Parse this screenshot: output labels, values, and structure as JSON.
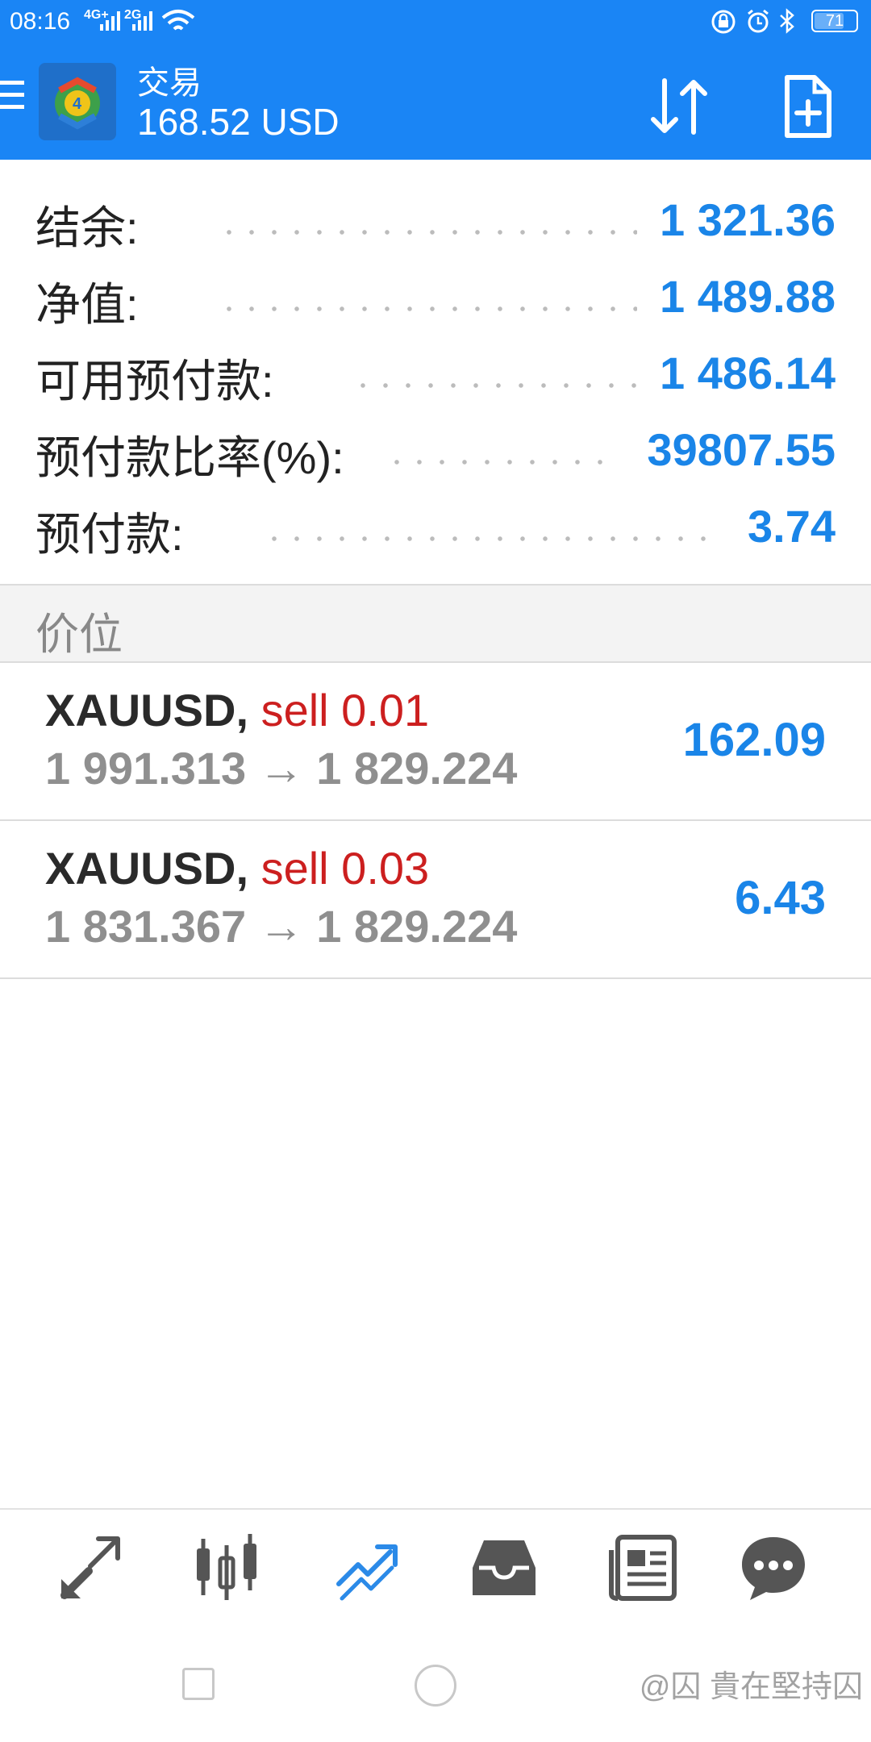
{
  "status_bar": {
    "time": "08:16",
    "net1": "4G+",
    "net2": "2G",
    "battery": "71"
  },
  "header": {
    "title": "交易",
    "subtitle": "168.52 USD",
    "icons": [
      "menu-icon",
      "app-logo",
      "sort-icon",
      "new-order-icon"
    ]
  },
  "summary": [
    {
      "label": "结余:",
      "value": "1 321.36"
    },
    {
      "label": "净值:",
      "value": "1 489.88"
    },
    {
      "label": "可用预付款:",
      "value": "1 486.14"
    },
    {
      "label": "预付款比率(%):",
      "value": "39807.55"
    },
    {
      "label": "预付款:",
      "value": "3.74"
    }
  ],
  "section_title": "价位",
  "positions": [
    {
      "symbol": "XAUUSD,",
      "side": "sell 0.01",
      "price_open": "1 991.313",
      "arrow": "→",
      "price_current": "1 829.224",
      "profit": "162.09"
    },
    {
      "symbol": "XAUUSD,",
      "side": "sell 0.03",
      "price_open": "1 831.367",
      "arrow": "→",
      "price_current": "1 829.224",
      "profit": "6.43"
    }
  ],
  "tabs": [
    "quotes-icon",
    "chart-icon",
    "trade-icon",
    "history-icon",
    "news-icon",
    "chat-icon"
  ],
  "active_tab": "trade-icon",
  "watermark": "@囚 貴在堅持囚",
  "colors": {
    "accent": "#1a85f5",
    "value_blue": "#1a85e8",
    "sell_red": "#cc1f1f"
  }
}
